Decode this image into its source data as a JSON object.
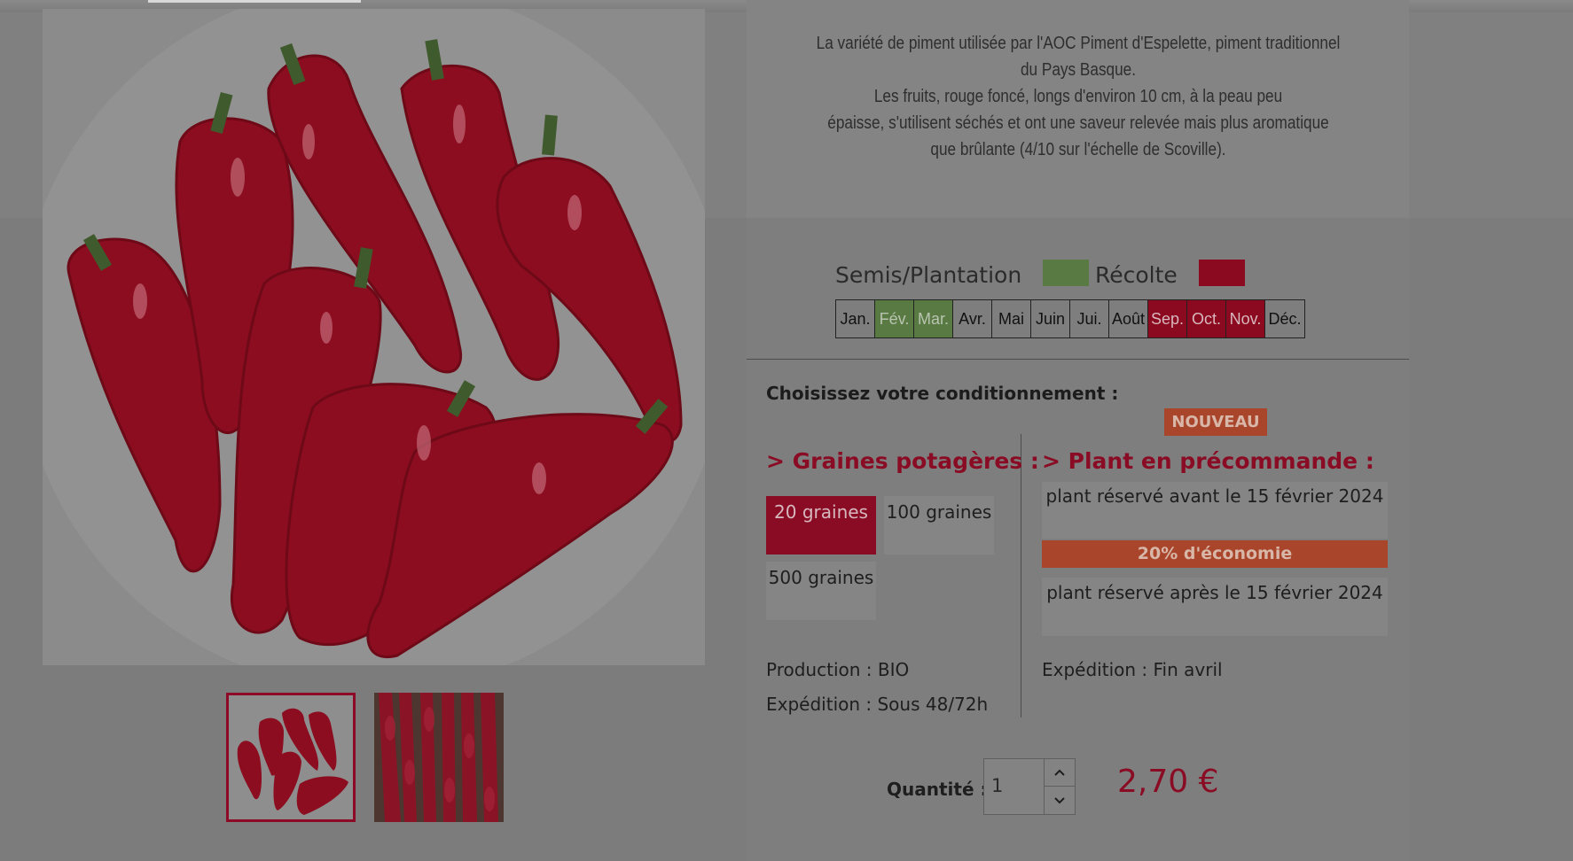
{
  "product": {
    "description_lines": [
      "La variété de piment utilisée par l'AOC Piment d'Espelette, piment traditionnel",
      "du Pays Basque.",
      "Les fruits, rouge foncé, longs d'environ 10 cm, à la peau peu",
      "épaisse, s'utilisent séchés et ont une saveur relevée mais plus aromatique",
      "que brûlante (4/10 sur l'échelle de Scoville)."
    ]
  },
  "calendar": {
    "legend_semis": "Semis/Plantation",
    "legend_recolte": "Récolte",
    "color_semis": "#5a7a44",
    "color_recolte": "#8c0a1f",
    "months": [
      {
        "label": "Jan.",
        "state": "none"
      },
      {
        "label": "Fév.",
        "state": "semis"
      },
      {
        "label": "Mar.",
        "state": "semis"
      },
      {
        "label": "Avr.",
        "state": "none"
      },
      {
        "label": "Mai",
        "state": "none"
      },
      {
        "label": "Juin",
        "state": "none"
      },
      {
        "label": "Jui.",
        "state": "none"
      },
      {
        "label": "Août",
        "state": "none"
      },
      {
        "label": "Sep.",
        "state": "recolte"
      },
      {
        "label": "Oct.",
        "state": "recolte"
      },
      {
        "label": "Nov.",
        "state": "recolte"
      },
      {
        "label": "Déc.",
        "state": "none"
      }
    ]
  },
  "packaging": {
    "choose_label": "Choisissez votre conditionnement :",
    "badge_new": "NOUVEAU",
    "graines": {
      "title": "> Graines potagères :",
      "options": [
        {
          "label": "20 graines",
          "selected": true
        },
        {
          "label": "100 graines",
          "selected": false
        },
        {
          "label": "500 graines",
          "selected": false
        }
      ],
      "production": "Production : BIO",
      "expedition": "Expédition : Sous 48/72h"
    },
    "plant": {
      "title": "> Plant en précommande :",
      "option_before": "plant réservé avant le 15 février 2024",
      "economy_badge": "20% d'économie",
      "option_after": "plant réservé après le 15 février 2024",
      "expedition": "Expédition : Fin avril"
    }
  },
  "purchase": {
    "quantity_label": "Quantité :",
    "quantity_value": "1",
    "price": "2,70 €"
  },
  "icons": {
    "qty_up": "chevron-up-icon",
    "qty_down": "chevron-down-icon"
  },
  "colors": {
    "accent": "#8a0c24",
    "badge": "#a9452a"
  }
}
